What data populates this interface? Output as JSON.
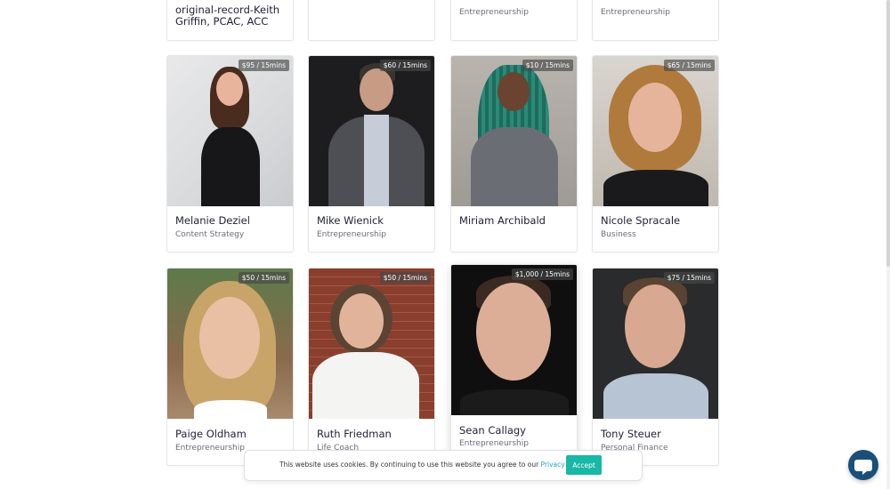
{
  "top_row": [
    {
      "name_lines": [
        "original-record-Keith",
        "Griffin, PCAC, ACC"
      ],
      "category": ""
    },
    {
      "name_lines": [],
      "category": ""
    },
    {
      "name_lines": [],
      "category": "Entrepreneurship"
    },
    {
      "name_lines": [],
      "category": "Entrepreneurship"
    }
  ],
  "experts": [
    {
      "name": "Melanie Deziel",
      "category": "Content Strategy",
      "price": "$95 / 15mins"
    },
    {
      "name": "Mike Wienick",
      "category": "Entrepreneurship",
      "price": "$60 / 15mins"
    },
    {
      "name": "Miriam Archibald",
      "category": "",
      "price": "$10 / 15mins"
    },
    {
      "name": "Nicole Spracale",
      "category": "Business",
      "price": "$65 / 15mins"
    },
    {
      "name": "Paige Oldham",
      "category": "Entrepreneurship",
      "price": "$50 / 15mins"
    },
    {
      "name": "Ruth Friedman",
      "category": "Life Coach",
      "price": "$50 / 15mins"
    },
    {
      "name": "Sean Callagy",
      "category": "Entrepreneurship",
      "price": "$1,000 / 15mins"
    },
    {
      "name": "Tony Steuer",
      "category": "Personal Finance",
      "price": "$75 / 15mins"
    }
  ],
  "cookie_banner": {
    "text": "This website uses cookies. By continuing to use this website you agree to our",
    "link": "Privacy Policy",
    "accept_label": "Accept"
  },
  "chat": {
    "icon": "chat-bubble-icon"
  },
  "colors": {
    "accent": "#19b7a6",
    "link": "#1aa7b5",
    "chat": "#1a4f7a"
  }
}
